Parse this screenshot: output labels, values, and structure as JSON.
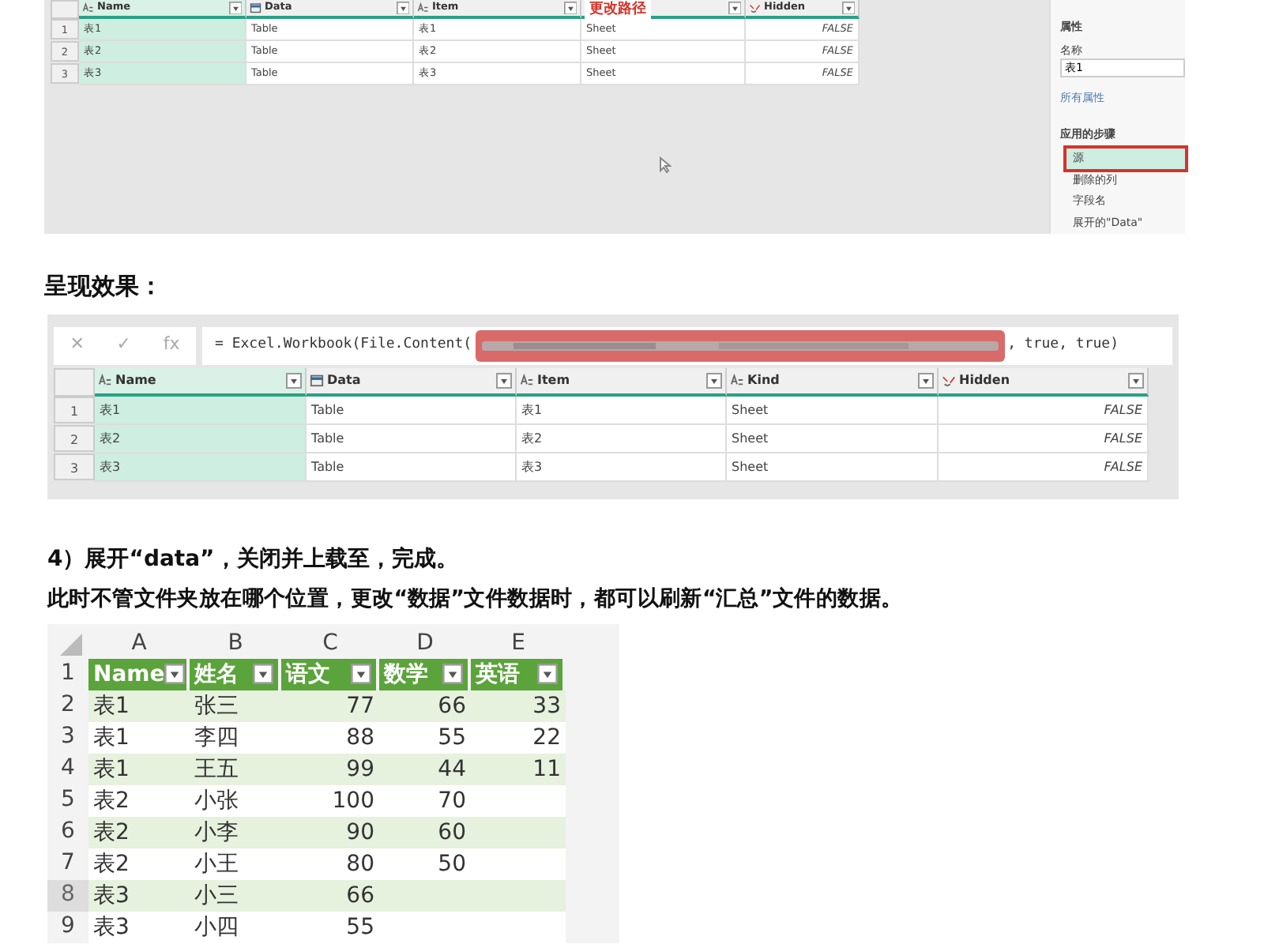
{
  "editor_before": {
    "columns": [
      {
        "label": "Name",
        "kind": "text",
        "selected": true
      },
      {
        "label": "Data",
        "kind": "table",
        "selected": false
      },
      {
        "label": "Item",
        "kind": "text",
        "selected": false
      },
      {
        "kind": "text",
        "selected": false
      },
      {
        "label": "Hidden",
        "kind": "logical",
        "selected": false
      }
    ],
    "annotation": "更改路径",
    "rows": [
      {
        "number": "1",
        "cells": [
          "表1",
          "Table",
          "表1",
          "Sheet",
          "FALSE"
        ]
      },
      {
        "number": "2",
        "cells": [
          "表2",
          "Table",
          "表2",
          "Sheet",
          "FALSE"
        ]
      },
      {
        "number": "3",
        "cells": [
          "表3",
          "Table",
          "表3",
          "Sheet",
          "FALSE"
        ]
      }
    ],
    "properties": {
      "heading": "属性",
      "name_label": "名称",
      "name_value": "表1",
      "all_properties": "所有属性"
    },
    "applied_steps": {
      "heading": "应用的步骤",
      "items": [
        {
          "label": "源",
          "selected": true
        },
        {
          "label": "删除的列",
          "selected": false
        },
        {
          "label": "字段名",
          "selected": false
        },
        {
          "label": "展开的\"Data\"",
          "selected": false
        }
      ]
    }
  },
  "result_heading": "呈现效果：",
  "editor_after": {
    "formula_buttons": [
      "✕",
      "✓",
      "fx"
    ],
    "formula_start": "= Excel.Workbook(File.Content(",
    "formula_end": ", true, true)",
    "columns": [
      {
        "label": "Name",
        "kind": "text",
        "selected": true
      },
      {
        "label": "Data",
        "kind": "table",
        "selected": false
      },
      {
        "label": "Item",
        "kind": "text",
        "selected": false
      },
      {
        "label": "Kind",
        "kind": "text",
        "selected": false
      },
      {
        "label": "Hidden",
        "kind": "logical",
        "selected": false
      }
    ],
    "rows": [
      {
        "number": "1",
        "cells": [
          "表1",
          "Table",
          "表1",
          "Sheet",
          "FALSE"
        ]
      },
      {
        "number": "2",
        "cells": [
          "表2",
          "Table",
          "表2",
          "Sheet",
          "FALSE"
        ]
      },
      {
        "number": "3",
        "cells": [
          "表3",
          "Table",
          "表3",
          "Sheet",
          "FALSE"
        ]
      }
    ]
  },
  "step_heading": "4）展开“data”，关闭并上载至，完成。",
  "step_note": "此时不管文件夹放在哪个位置，更改“数据”文件数据时，都可以刷新“汇总”文件的数据。",
  "sheet": {
    "column_letters": [
      "A",
      "B",
      "C",
      "D",
      "E"
    ],
    "rows": [
      {
        "number": "1",
        "kind": "header",
        "selected": false,
        "cells": [
          "Name",
          "姓名",
          "语文",
          "数学",
          "英语"
        ]
      },
      {
        "number": "2",
        "kind": "data",
        "selected": false,
        "cells": [
          "表1",
          "张三",
          "77",
          "66",
          "33"
        ]
      },
      {
        "number": "3",
        "kind": "data",
        "selected": false,
        "cells": [
          "表1",
          "李四",
          "88",
          "55",
          "22"
        ]
      },
      {
        "number": "4",
        "kind": "data",
        "selected": false,
        "cells": [
          "表1",
          "王五",
          "99",
          "44",
          "11"
        ]
      },
      {
        "number": "5",
        "kind": "data",
        "selected": false,
        "cells": [
          "表2",
          "小张",
          "100",
          "70",
          ""
        ]
      },
      {
        "number": "6",
        "kind": "data",
        "selected": false,
        "cells": [
          "表2",
          "小李",
          "90",
          "60",
          ""
        ]
      },
      {
        "number": "7",
        "kind": "data",
        "selected": false,
        "cells": [
          "表2",
          "小王",
          "80",
          "50",
          ""
        ]
      },
      {
        "number": "8",
        "kind": "data",
        "selected": true,
        "cells": [
          "表3",
          "小三",
          "66",
          "",
          ""
        ]
      },
      {
        "number": "9",
        "kind": "data",
        "selected": false,
        "cells": [
          "表3",
          "小四",
          "55",
          "",
          ""
        ]
      }
    ]
  }
}
